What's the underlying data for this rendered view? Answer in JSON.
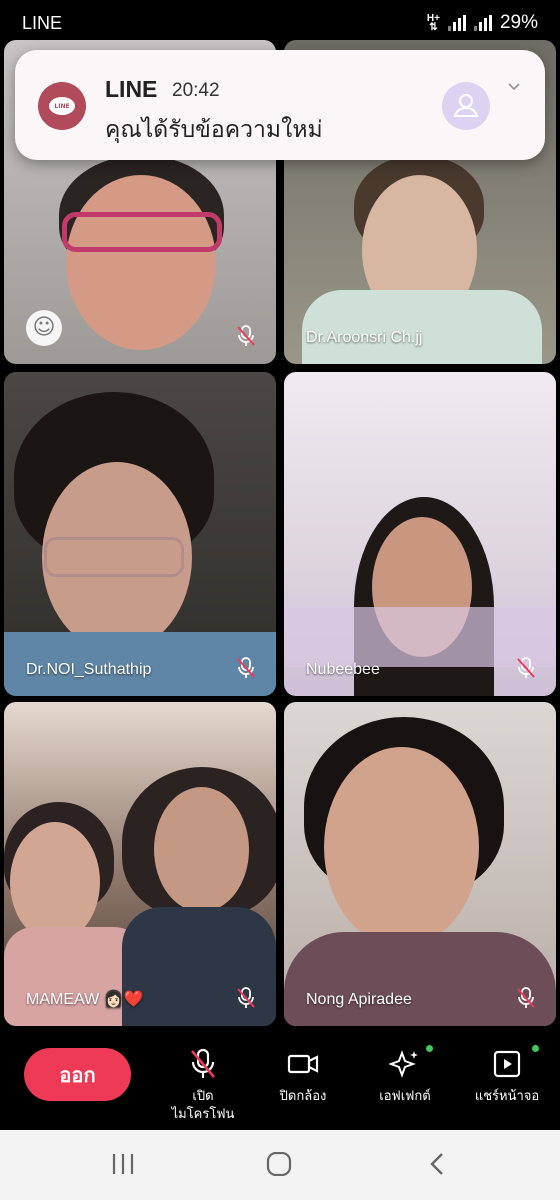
{
  "status_bar": {
    "app_label": "LINE",
    "network": "H+",
    "battery": "29%"
  },
  "notification": {
    "app": "LINE",
    "time": "20:42",
    "message": "คุณได้รับข้อความใหม่",
    "icons": [
      "line-logo-icon",
      "person-icon",
      "chevron-down-icon"
    ]
  },
  "participants": [
    {
      "name": "",
      "tile_color": "#b7b2b0",
      "mic_muted": true,
      "emoji_button": true
    },
    {
      "name": "Dr.Aroonsri Ch.jj",
      "tile_color": "#8c8a76",
      "mic_muted": false
    },
    {
      "name": "Dr.NOI_Suthathip",
      "tile_color": "#3e3b38",
      "mic_muted": true
    },
    {
      "name": "Nubeebee",
      "tile_color": "#e9dfe6",
      "mic_muted": true
    },
    {
      "name": "MAMEAW 👩🏻❤️",
      "tile_color": "#a8928c",
      "mic_muted": true
    },
    {
      "name": "Nong Apiradee",
      "tile_color": "#c9c0bb",
      "mic_muted": true
    }
  ],
  "toolbar": {
    "leave_label": "ออก",
    "mic_label_line1": "เปิด",
    "mic_label_line2": "ไมโครโฟน",
    "camera_label": "ปิดกล้อง",
    "effects_label": "เอฟเฟกต์",
    "share_label": "แชร์หน้าจอ",
    "accent_color": "#ee3a57",
    "muted_color": "#ee3a57",
    "indicator_color": "#3ecb5c"
  },
  "navbar": {
    "icons": [
      "recent-apps-icon",
      "home-icon",
      "back-icon"
    ]
  }
}
